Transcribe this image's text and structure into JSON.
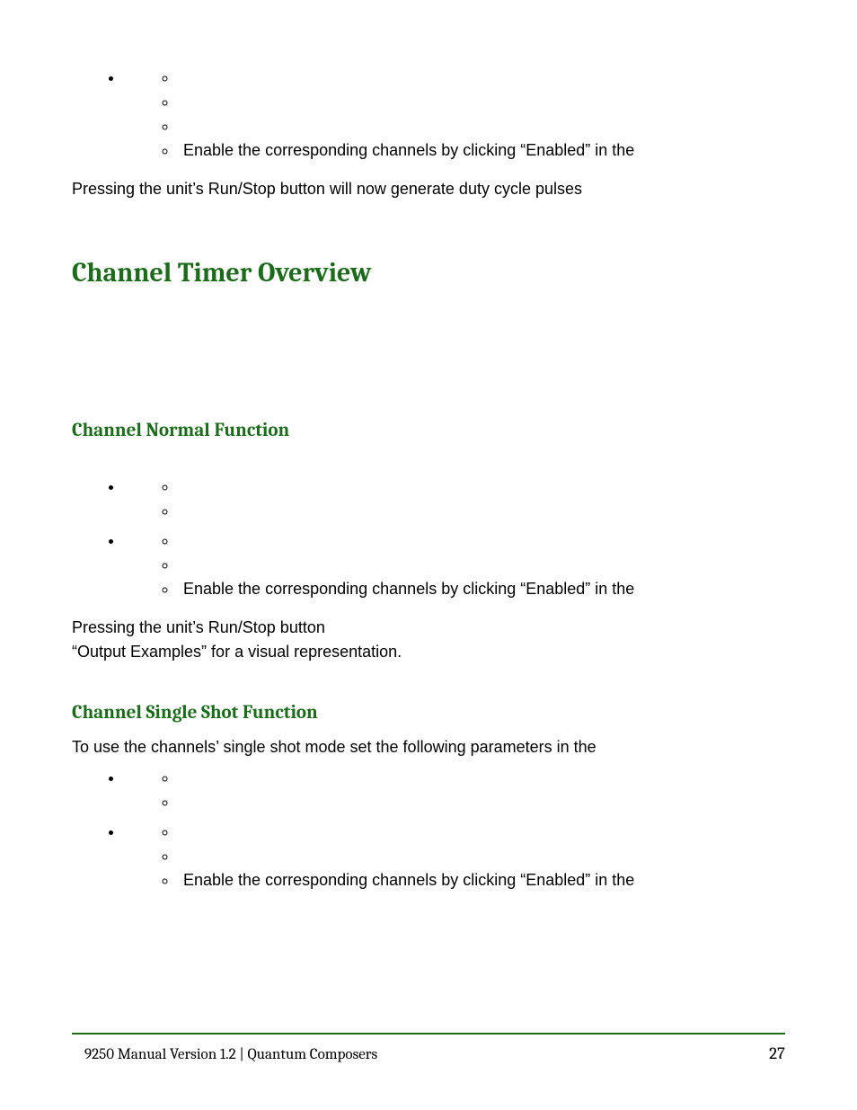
{
  "top": {
    "list1": {
      "items": [
        {
          "text": ""
        },
        {
          "text": ""
        },
        {
          "text": ""
        },
        {
          "text": "Enable the corresponding channels by clicking “Enabled” in the"
        }
      ]
    },
    "para": "Pressing the unit’s Run/Stop button will now generate duty cycle pulses"
  },
  "heading": "Channel Timer Overview",
  "normal": {
    "title": "Channel Normal Function",
    "group1": {
      "items": [
        {
          "text": ""
        },
        {
          "text": ""
        }
      ]
    },
    "group2": {
      "items": [
        {
          "text": ""
        },
        {
          "text": ""
        },
        {
          "text": "Enable the corresponding channels by clicking “Enabled” in the"
        }
      ]
    },
    "para1": "Pressing the unit’s Run/Stop button",
    "para2": "“Output Examples” for a visual representation."
  },
  "single": {
    "title": "Channel Single Shot Function",
    "intro": "To use the channels’ single shot mode set the following parameters in the",
    "group1": {
      "items": [
        {
          "text": ""
        },
        {
          "text": ""
        }
      ]
    },
    "group2": {
      "items": [
        {
          "text": ""
        },
        {
          "text": ""
        },
        {
          "text": "Enable the corresponding channels by clicking “Enabled” in the"
        }
      ]
    }
  },
  "footer": {
    "left": "9250 Manual Version 1.2  |  Quantum Composers",
    "page": "27"
  }
}
